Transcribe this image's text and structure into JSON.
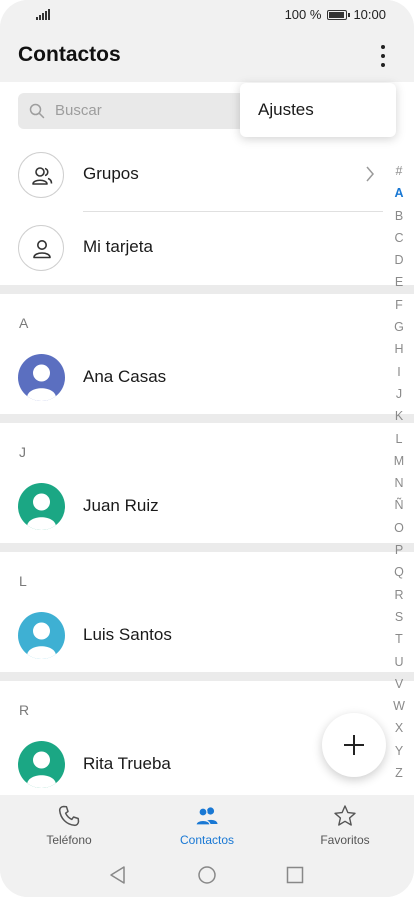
{
  "status_bar": {
    "battery_text": "100 %",
    "time": "10:00",
    "battery_level": 1.0
  },
  "header": {
    "title": "Contactos",
    "more_icon": "more-vertical-icon"
  },
  "search": {
    "placeholder": "Buscar",
    "icon": "search-icon"
  },
  "menu": {
    "items": [
      {
        "label": "Ajustes"
      }
    ]
  },
  "top_rows": [
    {
      "label": "Grupos",
      "icon": "groups-icon"
    },
    {
      "label": "Mi tarjeta",
      "icon": "person-icon"
    }
  ],
  "sections": [
    {
      "letter": "A",
      "contacts": [
        {
          "name": "Ana Casas",
          "avatar_color": "#5b6fc0"
        }
      ]
    },
    {
      "letter": "J",
      "contacts": [
        {
          "name": "Juan Ruiz",
          "avatar_color": "#1ba784"
        }
      ]
    },
    {
      "letter": "L",
      "contacts": [
        {
          "name": "Luis Santos",
          "avatar_color": "#3eb0d3"
        }
      ]
    },
    {
      "letter": "R",
      "contacts": [
        {
          "name": "Rita Trueba",
          "avatar_color": "#1ba784"
        }
      ]
    }
  ],
  "alphabet_index": {
    "letters": [
      "#",
      "A",
      "B",
      "C",
      "D",
      "E",
      "F",
      "G",
      "H",
      "I",
      "J",
      "K",
      "L",
      "M",
      "N",
      "Ñ",
      "O",
      "P",
      "Q",
      "R",
      "S",
      "T",
      "U",
      "V",
      "W",
      "X",
      "Y",
      "Z"
    ],
    "active": "A"
  },
  "fab": {
    "icon": "plus-icon"
  },
  "bottom_nav": [
    {
      "label": "Teléfono",
      "icon": "phone-icon",
      "active": false
    },
    {
      "label": "Contactos",
      "icon": "contacts-icon",
      "active": true
    },
    {
      "label": "Favoritos",
      "icon": "star-icon",
      "active": false
    }
  ],
  "colors": {
    "accent": "#1978d4",
    "background": "#f1f1f1"
  }
}
